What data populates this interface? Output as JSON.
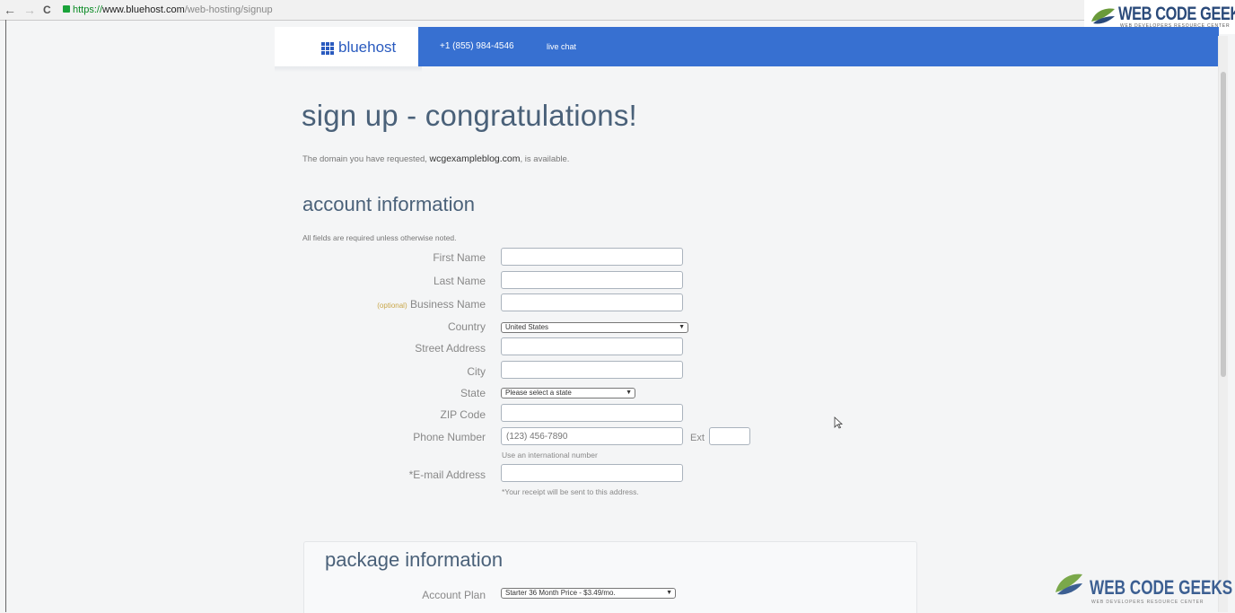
{
  "browser": {
    "back": "←",
    "forward": "→",
    "reload": "C",
    "url_scheme": "https://",
    "url_host": "www.bluehost.com",
    "url_path": "/web-hosting/signup"
  },
  "watermark": {
    "brand": "WEB CODE GEEKS",
    "tagline": "WEB DEVELOPERS RESOURCE CENTER"
  },
  "header": {
    "logo": "bluehost",
    "phone": "+1 (855) 984-4546",
    "live_chat": "live chat"
  },
  "page": {
    "title": "sign up - congratulations!",
    "domain_prefix": "The domain you have requested, ",
    "domain": "wcgexampleblog.com",
    "domain_suffix": ", is available."
  },
  "account": {
    "heading": "account information",
    "note": "All fields are required unless otherwise noted.",
    "first_name_label": "First Name",
    "last_name_label": "Last Name",
    "optional_tag": "(optional)",
    "business_name_label": " Business Name",
    "country_label": "Country",
    "country_value": "United States",
    "street_label": "Street Address",
    "city_label": "City",
    "state_label": "State",
    "state_value": "Please select a state",
    "zip_label": "ZIP Code",
    "phone_label": "Phone Number",
    "phone_placeholder": "(123) 456-7890",
    "ext_label": "Ext",
    "phone_hint": "Use an international number",
    "email_label": "*E-mail Address",
    "email_hint": "*Your receipt will be sent to this address."
  },
  "package": {
    "heading": "package information",
    "plan_label": "Account Plan",
    "plan_value": "Starter 36 Month Price - $3.49/mo."
  },
  "colors": {
    "brand_blue": "#3770d1",
    "heading": "#4a6179"
  }
}
